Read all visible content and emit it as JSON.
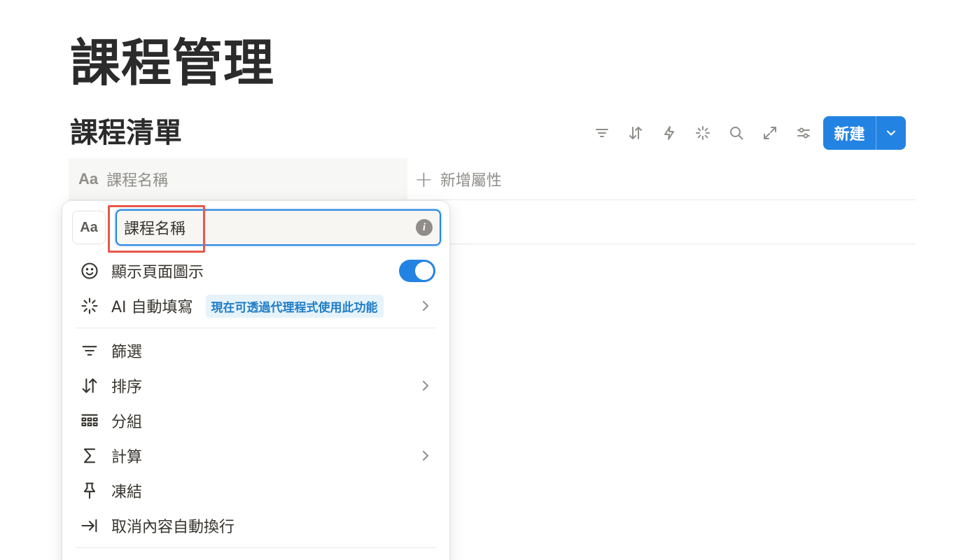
{
  "page": {
    "title": "課程管理"
  },
  "database": {
    "title": "課程清單"
  },
  "toolbar": {
    "icons": [
      "filter-icon",
      "sort-icon",
      "automation-icon",
      "ai-sparkle-icon",
      "search-icon",
      "expand-icon",
      "settings-icon"
    ],
    "new_label": "新建"
  },
  "table": {
    "column": {
      "type_icon_label": "Aa",
      "name": "課程名稱"
    },
    "add_property_label": "新增屬性"
  },
  "menu": {
    "type_icon_label": "Aa",
    "name_input_value": "課程名稱",
    "info_icon_label": "i",
    "items": [
      {
        "label": "顯示頁面圖示",
        "icon": "smiley-icon",
        "toggle_on": true
      },
      {
        "label": "AI 自動填寫",
        "icon": "ai-sparkle-icon",
        "badge": "現在可透過代理程式使用此功能",
        "has_submenu": true
      },
      {
        "label": "篩選",
        "icon": "filter-icon"
      },
      {
        "label": "排序",
        "icon": "sort-icon",
        "has_submenu": true
      },
      {
        "label": "分組",
        "icon": "group-icon"
      },
      {
        "label": "計算",
        "icon": "sigma-icon",
        "has_submenu": true
      },
      {
        "label": "凍結",
        "icon": "pin-icon"
      },
      {
        "label": "取消內容自動換行",
        "icon": "wrap-icon"
      }
    ]
  },
  "colors": {
    "accent": "#2383e2",
    "highlight_box": "#e8574c",
    "badge_bg": "#e7f3fb",
    "badge_text": "#1f7dc7"
  }
}
